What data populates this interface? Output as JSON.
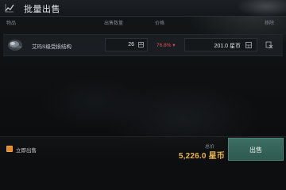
{
  "header": {
    "title": "批量出售",
    "icon": "chart-trend-icon"
  },
  "columns": {
    "item": "物品",
    "quantity": "出售数量",
    "price": "价格",
    "remove": "移除"
  },
  "item_row": {
    "thumbnail": "ship-part-icon",
    "name": "艾玛S级受损结构",
    "quantity": "26",
    "quantity_icon": "quantity-box-icon",
    "percent": "76.8% ▾",
    "price": "201.0 星币",
    "price_icon": "price-box-icon",
    "remove_icon": "remove-icon"
  },
  "footer": {
    "instant_sell_label": "立即出售",
    "instant_sell_checked": true,
    "total_label": "总价",
    "total_value": "5,226.0 星币",
    "sell_button_label": "出售"
  },
  "colors": {
    "accent_orange": "#e2892a",
    "total_gold": "#e9b64a",
    "percent_red": "#e0505a",
    "sell_button": "#2e5a50"
  }
}
